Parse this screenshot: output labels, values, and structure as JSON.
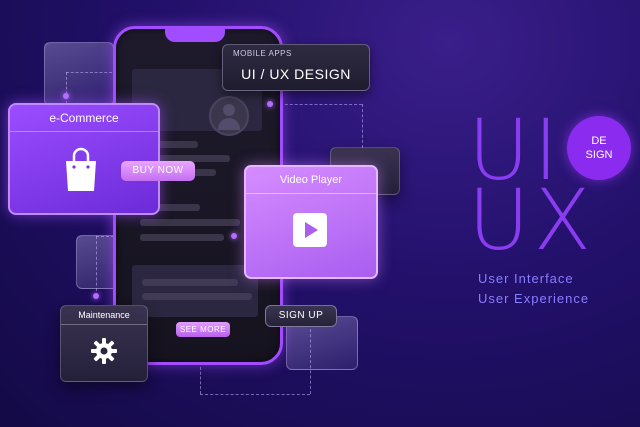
{
  "mobile_apps": {
    "small": "MOBILE APPS",
    "title": "UI / UX DESIGN"
  },
  "ecommerce": {
    "title": "e-Commerce",
    "icon": "shopping-bag-icon"
  },
  "buttons": {
    "buy_now": "BUY NOW",
    "see_more": "SEE  MORE",
    "sign_up": "SIGN UP"
  },
  "video_player": {
    "title": "Video Player",
    "icon": "play-icon"
  },
  "maintenance": {
    "title": "Maintenance",
    "icon": "gear-icon"
  },
  "branding": {
    "line1": "UI",
    "line2": "UX",
    "badge_line1": "DE",
    "badge_line2": "SIGN",
    "tagline1": "User Interface",
    "tagline2": "User Experience"
  },
  "colors": {
    "accent": "#a24cff",
    "background": "#22106a",
    "text_accent": "#8a7dff"
  }
}
